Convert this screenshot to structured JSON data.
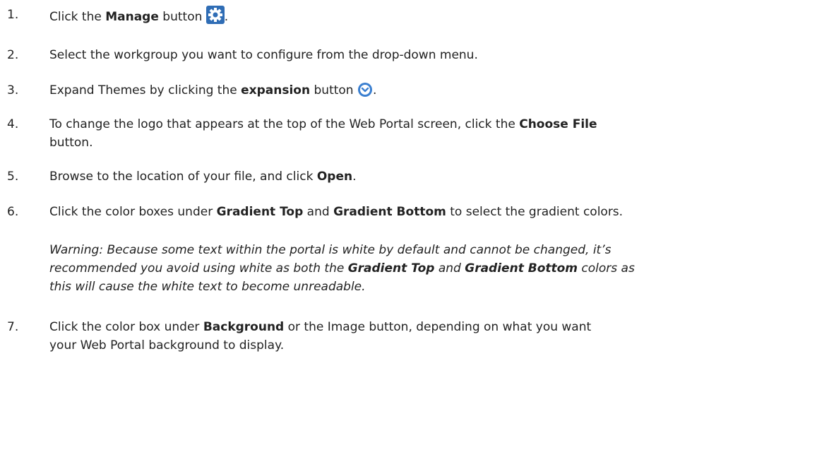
{
  "steps": [
    {
      "number": "1.",
      "pre": "Click the ",
      "bold": "Manage",
      "post": " button",
      "icon": "gear-icon",
      "end": "."
    },
    {
      "number": "2.",
      "text": "Select the workgroup you want to configure from the drop-down menu."
    },
    {
      "number": "3.",
      "pre": "Expand Themes by clicking the ",
      "bold": "expansion",
      "post": " button",
      "icon": "chevron-down-circle-icon",
      "end": "."
    },
    {
      "number": "4.",
      "pre": "To change the logo that appears at the top of the Web Portal screen, click the ",
      "bold": "Choose File",
      "line2": "button."
    },
    {
      "number": "5.",
      "pre": "Browse to the location of your file, and click ",
      "bold": "Open",
      "end": "."
    },
    {
      "number": "6.",
      "pre": "Click the color boxes under ",
      "bold1": "Gradient Top",
      "mid": " and ",
      "bold2": "Gradient Bottom",
      "post": " to select the gradient colors."
    },
    {
      "number": "7.",
      "pre": "Click the color box under ",
      "bold": "Background",
      "post": " or the Image button, depending on what you want",
      "line2": "your Web Portal background to display."
    }
  ],
  "warning": {
    "pre": "Warning: Because some text within the portal is white by default and cannot be changed, it’s",
    "line2_pre": "recommended you avoid using white as both the ",
    "bold1": "Gradient Top",
    "mid": " and ",
    "bold2": "Gradient Bottom",
    "post": " colors as",
    "line3": "this will cause the white text to become unreadable."
  },
  "colors": {
    "gear_blue": "#2f6db5",
    "chevron_blue": "#3a7fd0"
  }
}
